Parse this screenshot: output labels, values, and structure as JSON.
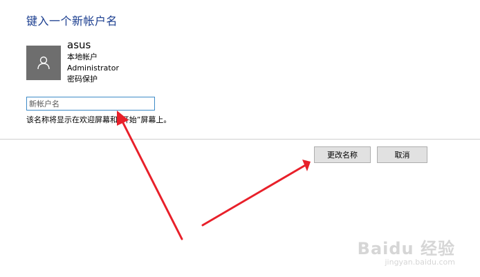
{
  "title": "键入一个新帐户名",
  "account": {
    "avatar_icon": "user-icon",
    "name": "asus",
    "type": "本地帐户",
    "role": "Administrator",
    "protection": "密码保护"
  },
  "rename_field": {
    "placeholder": "新帐户名",
    "value": ""
  },
  "hint": "该名称将显示在欢迎屏幕和“开始”屏幕上。",
  "buttons": {
    "rename": "更改名称",
    "cancel": "取消"
  },
  "annotation": {
    "arrow_color": "#e8202a"
  },
  "watermark": {
    "logo": "Baidu 经验",
    "url": "jingyan.baidu.com"
  },
  "colors": {
    "title": "#1a3d8f",
    "avatar_bg": "#6e6e6e",
    "input_border": "#3c8ac7",
    "button_bg": "#e1e1e1"
  }
}
